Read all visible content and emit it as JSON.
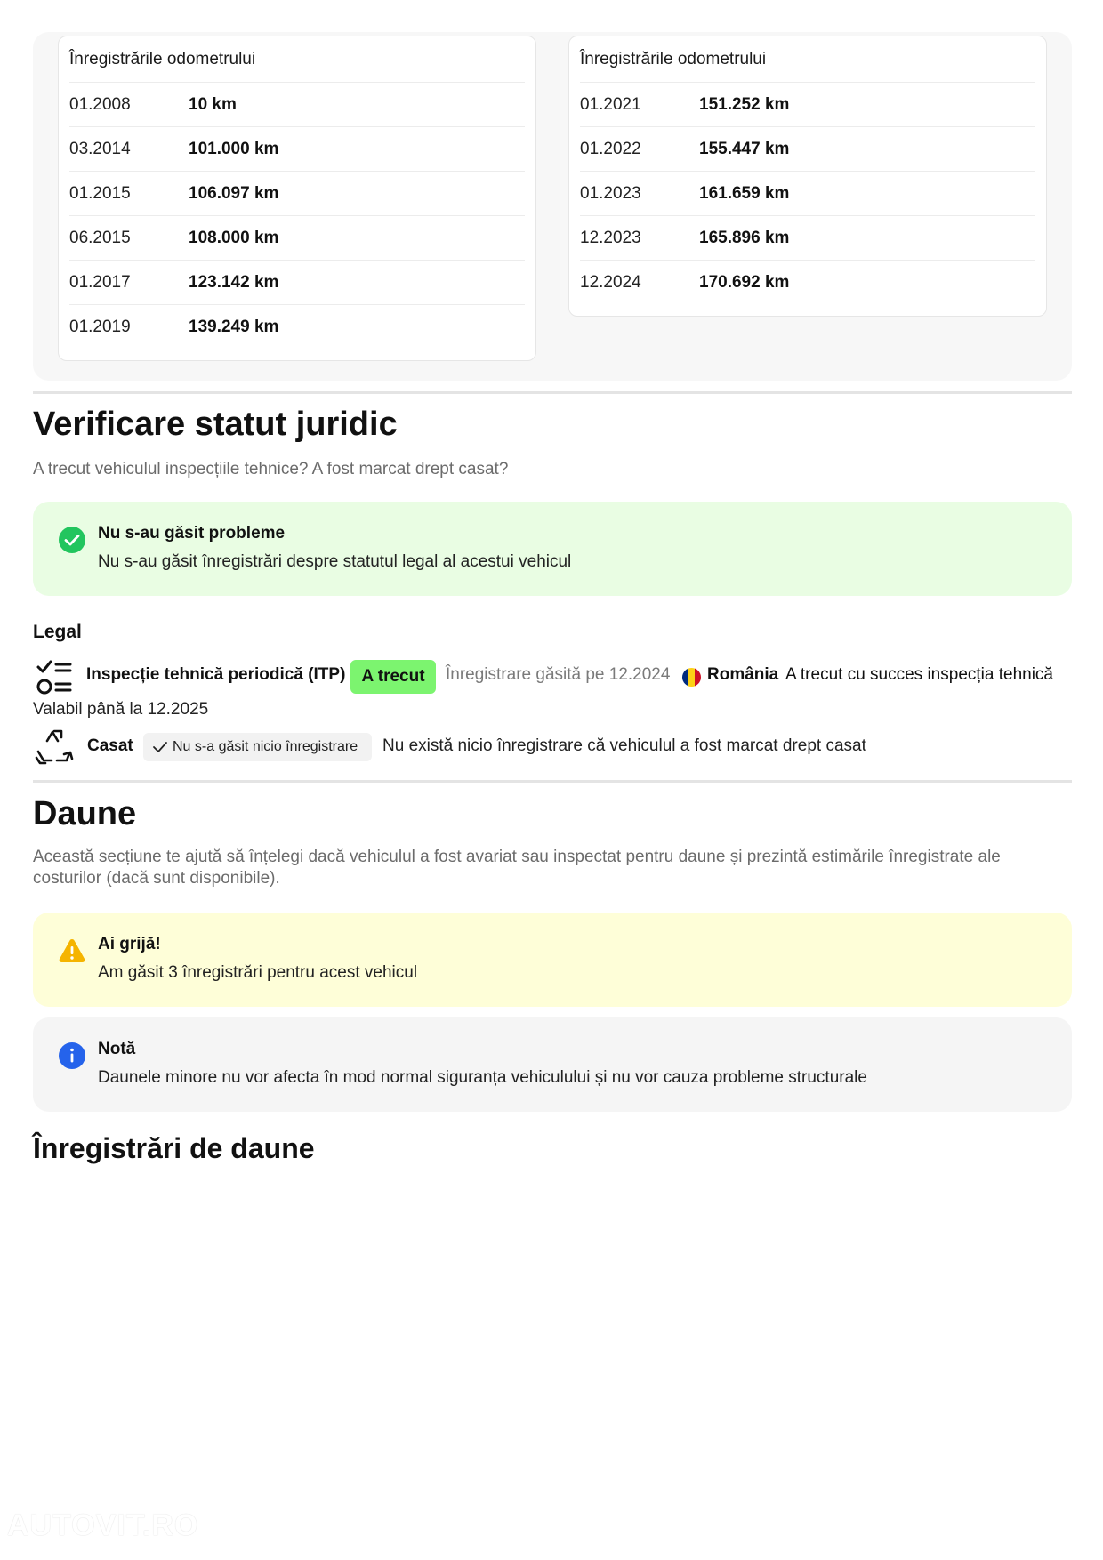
{
  "odometer": {
    "left_card": {
      "title": "Înregistrările odometrului",
      "rows": [
        {
          "date": "01.2008",
          "km": "10 km"
        },
        {
          "date": "03.2014",
          "km": "101.000 km"
        },
        {
          "date": "01.2015",
          "km": "106.097 km"
        },
        {
          "date": "06.2015",
          "km": "108.000 km"
        },
        {
          "date": "01.2017",
          "km": "123.142 km"
        },
        {
          "date": "01.2019",
          "km": "139.249 km"
        }
      ]
    },
    "right_card": {
      "title": "Înregistrările odometrului",
      "rows": [
        {
          "date": "01.2021",
          "km": "151.252 km"
        },
        {
          "date": "01.2022",
          "km": "155.447 km"
        },
        {
          "date": "01.2023",
          "km": "161.659 km"
        },
        {
          "date": "12.2023",
          "km": "165.896 km"
        },
        {
          "date": "12.2024",
          "km": "170.692 km"
        }
      ]
    }
  },
  "legal_status": {
    "title": "Verificare statut juridic",
    "subtitle": "A trecut vehiculul inspecțiile tehnice? A fost marcat drept casat?",
    "alert": {
      "title": "Nu s-au găsit probleme",
      "text": "Nu s-au găsit înregistrări despre statutul legal al acestui vehicul",
      "icon": "check-circle-icon",
      "color": "#22c55e"
    },
    "legal_heading": "Legal",
    "itp": {
      "label": "Inspecție tehnică periodică (ITP)",
      "status": "A trecut",
      "status_color": "#7cf46f",
      "found": "Înregistrare găsită pe 12.2024",
      "country": "România",
      "flag_colors": [
        "#002b7f",
        "#fcd116",
        "#ce1126"
      ],
      "result": "A trecut cu succes inspecția tehnică",
      "valid_until": "Valabil până la 12.2025",
      "icon": "checklist-icon"
    },
    "casat": {
      "label": "Casat",
      "badge": "Nu s-a găsit nicio înregistrare",
      "text": "Nu există nicio înregistrare că vehiculul a fost marcat drept casat",
      "icon": "recycle-icon"
    }
  },
  "damage": {
    "title": "Daune",
    "description": "Această secțiune te ajută să înțelegi dacă vehiculul a fost avariat sau inspectat pentru daune și prezintă estimările înregistrate ale",
    "description_line2": "costurilor (dacă sunt disponibile).",
    "warning": {
      "title": "Ai grijă!",
      "text": "Am găsit 3 înregistrări pentru acest vehicul",
      "icon": "warning-icon",
      "color": "#f5b400"
    },
    "note": {
      "title": "Notă",
      "text": "Daunele minore nu vor afecta în mod normal siguranța vehiculului și nu vor cauza probleme structurale",
      "icon": "info-icon",
      "color": "#2563eb"
    },
    "records_title": "Înregistrări de daune"
  },
  "watermark": "AUTOVIT.RO"
}
